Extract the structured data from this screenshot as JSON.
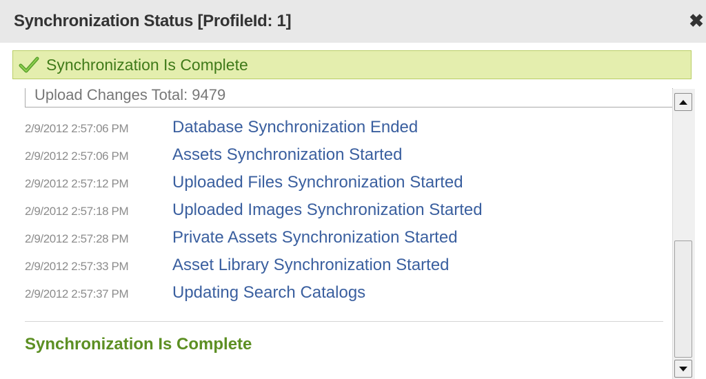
{
  "dialog": {
    "title": "Synchronization Status [ProfileId: 1]",
    "close_icon": "close-icon"
  },
  "banner": {
    "icon": "checkmark-icon",
    "text": "Synchronization Is Complete",
    "bg_color": "#e4eeae",
    "text_color": "#3f7a19"
  },
  "log": {
    "upload_total": "Upload Changes Total: 9479",
    "entries": [
      {
        "time": "2/9/2012 2:57:06 PM",
        "message": "Database Synchronization Ended"
      },
      {
        "time": "2/9/2012 2:57:06 PM",
        "message": "Assets Synchronization Started"
      },
      {
        "time": "2/9/2012 2:57:12 PM",
        "message": "Uploaded Files Synchronization Started"
      },
      {
        "time": "2/9/2012 2:57:18 PM",
        "message": "Uploaded Images Synchronization Started"
      },
      {
        "time": "2/9/2012 2:57:28 PM",
        "message": "Private Assets Synchronization Started"
      },
      {
        "time": "2/9/2012 2:57:33 PM",
        "message": "Asset Library Synchronization Started"
      },
      {
        "time": "2/9/2012 2:57:37 PM",
        "message": "Updating Search Catalogs"
      }
    ],
    "complete_text": "Synchronization Is Complete",
    "message_color": "#3a5f9f",
    "complete_color": "#5c8f23"
  },
  "scrollbar": {
    "up_icon": "scroll-up-arrow-icon",
    "down_icon": "scroll-down-arrow-icon"
  }
}
